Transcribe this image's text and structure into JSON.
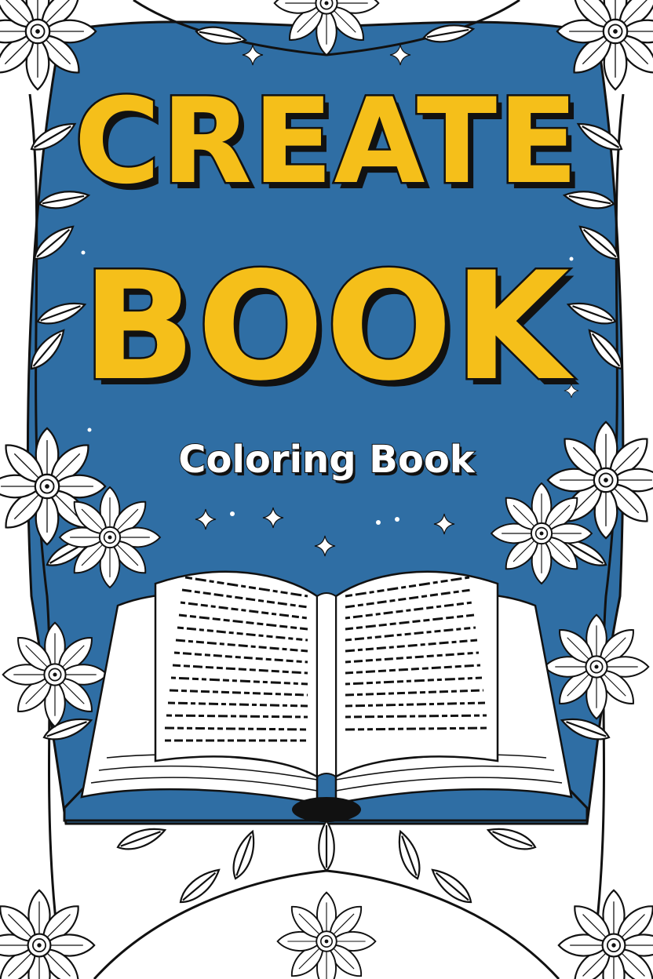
{
  "cover": {
    "title_line_1": "CREATE",
    "title_line_2": "BOOK",
    "subtitle": "Coloring Book"
  },
  "colors": {
    "background_blue": "#2f6ea4",
    "title_yellow": "#f5bf1a",
    "outline": "#111111",
    "paper": "#ffffff"
  },
  "icons": [
    "flower-icon",
    "leaf-icon",
    "sparkle-icon",
    "open-book-icon"
  ]
}
